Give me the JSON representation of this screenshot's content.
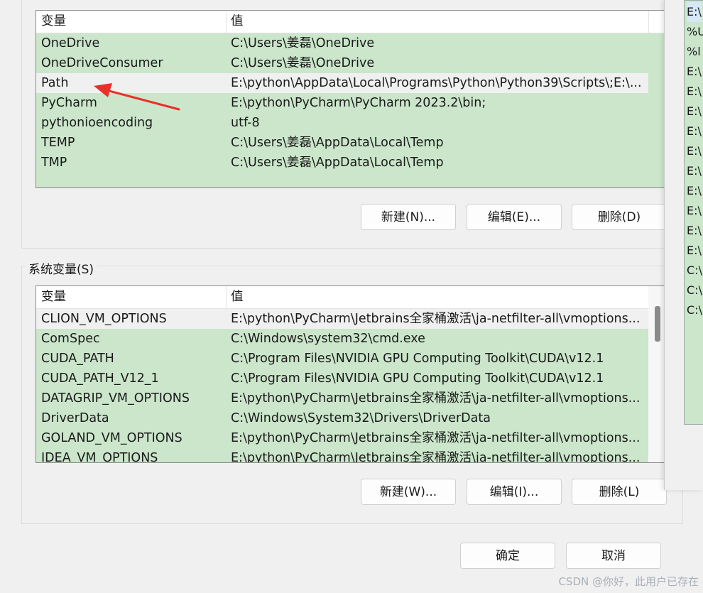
{
  "user_vars": {
    "headers": [
      "变量",
      "值"
    ],
    "rows": [
      {
        "name": "OneDrive",
        "value": "C:\\Users\\姜磊\\OneDrive"
      },
      {
        "name": "OneDriveConsumer",
        "value": "C:\\Users\\姜磊\\OneDrive"
      },
      {
        "name": "Path",
        "value": "E:\\python\\AppData\\Local\\Programs\\Python\\Python39\\Scripts\\;E:\\..."
      },
      {
        "name": "PyCharm",
        "value": "E:\\python\\PyCharm\\PyCharm 2023.2\\bin;"
      },
      {
        "name": "pythonioencoding",
        "value": "utf-8"
      },
      {
        "name": "TEMP",
        "value": "C:\\Users\\姜磊\\AppData\\Local\\Temp"
      },
      {
        "name": "TMP",
        "value": "C:\\Users\\姜磊\\AppData\\Local\\Temp"
      }
    ],
    "selected_row": 2,
    "buttons": {
      "new": "新建(N)...",
      "edit": "编辑(E)...",
      "delete": "删除(D)"
    }
  },
  "system_vars": {
    "title": "系统变量(S)",
    "headers": [
      "变量",
      "值"
    ],
    "rows": [
      {
        "name": "CLION_VM_OPTIONS",
        "value": "E:\\python\\PyCharm\\Jetbrains全家桶激活\\ja-netfilter-all\\vmoptions..."
      },
      {
        "name": "ComSpec",
        "value": "C:\\Windows\\system32\\cmd.exe"
      },
      {
        "name": "CUDA_PATH",
        "value": "C:\\Program Files\\NVIDIA GPU Computing Toolkit\\CUDA\\v12.1"
      },
      {
        "name": "CUDA_PATH_V12_1",
        "value": "C:\\Program Files\\NVIDIA GPU Computing Toolkit\\CUDA\\v12.1"
      },
      {
        "name": "DATAGRIP_VM_OPTIONS",
        "value": "E:\\python\\PyCharm\\Jetbrains全家桶激活\\ja-netfilter-all\\vmoptions..."
      },
      {
        "name": "DriverData",
        "value": "C:\\Windows\\System32\\Drivers\\DriverData"
      },
      {
        "name": "GOLAND_VM_OPTIONS",
        "value": "E:\\python\\PyCharm\\Jetbrains全家桶激活\\ja-netfilter-all\\vmoptions..."
      },
      {
        "name": "IDEA_VM_OPTIONS",
        "value": "E:\\python\\PyCharm\\Jetbrains全家桶激活\\ja-netfilter-all\\vmoptions..."
      }
    ],
    "buttons": {
      "new": "新建(W)...",
      "edit": "编辑(I)...",
      "delete": "删除(L)"
    }
  },
  "dialog_buttons": {
    "ok": "确定",
    "cancel": "取消"
  },
  "side_list_items": [
    "E:\\",
    "%U",
    "%l",
    "E:\\",
    "E:\\",
    "E:\\",
    "E:\\",
    "E:\\",
    "E:\\",
    "E:\\",
    "E:\\",
    "E:\\",
    "E:\\",
    "C:\\",
    "C:\\",
    "C:\\"
  ],
  "watermark": "CSDN @你好，此用户已存在",
  "colors": {
    "row_green": "#cbe6cb",
    "arrow_red": "#e8312a"
  }
}
